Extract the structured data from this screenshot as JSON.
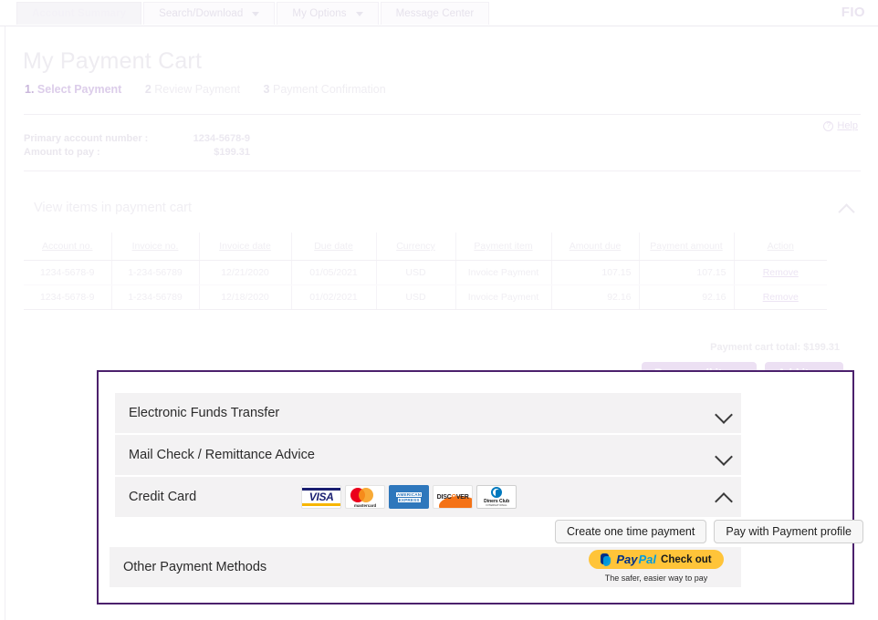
{
  "topnav": {
    "tabs": [
      {
        "label": "Account Summary",
        "active": true,
        "caret": false
      },
      {
        "label": "Search/Download",
        "active": false,
        "caret": true
      },
      {
        "label": "My Options",
        "active": false,
        "caret": true
      },
      {
        "label": "Message Center",
        "active": false,
        "caret": false
      }
    ],
    "brand": "FIO"
  },
  "page": {
    "title": "My Payment Cart",
    "steps": [
      {
        "num": "1.",
        "label": "Select Payment",
        "current": true
      },
      {
        "num": "2",
        "label": "Review Payment",
        "current": false
      },
      {
        "num": "3",
        "label": "Payment Confirmation",
        "current": false
      }
    ],
    "help": {
      "icon": "question-circle-icon",
      "label": "Help"
    }
  },
  "account_info": [
    {
      "key": "Primary account number :",
      "value": "1234-5678-9"
    },
    {
      "key": "Amount to pay :",
      "value": "$199.31"
    }
  ],
  "cart_section": {
    "header": "View items in payment cart",
    "collapse_icon": "chevron-up-icon",
    "columns": [
      "Account no.",
      "Invoice no.",
      "Invoice date",
      "Due date",
      "Currency",
      "Payment item",
      "Amount due",
      "Payment amount",
      "Action"
    ],
    "rows": [
      {
        "account_no": "1234-5678-9",
        "invoice_no": "1-234-56789",
        "invoice_date": "12/21/2020",
        "due_date": "01/05/2021",
        "currency": "USD",
        "payment_item": "Invoice Payment",
        "amount_due": "107.15",
        "payment_amount": "107.15",
        "action": "Remove"
      },
      {
        "account_no": "1234-5678-9",
        "invoice_no": "1-234-56789",
        "invoice_date": "12/18/2020",
        "due_date": "01/02/2021",
        "currency": "USD",
        "payment_item": "Invoice Payment",
        "amount_due": "92.16",
        "payment_amount": "92.16",
        "action": "Remove"
      }
    ],
    "total_label": "Payment cart total: $199.31",
    "remove_all_label": "Remove all items",
    "add_items_label": "Add items"
  },
  "payment_methods": {
    "border_color": "#4b206c",
    "eft": {
      "label": "Electronic Funds Transfer",
      "icon": "chevron-down-icon"
    },
    "mail": {
      "label": "Mail Check / Remittance Advice",
      "icon": "chevron-down-icon"
    },
    "credit_card": {
      "label": "Credit Card",
      "icon": "chevron-up-icon",
      "cards": [
        {
          "name": "visa-logo",
          "text": "VISA"
        },
        {
          "name": "mastercard-logo",
          "text": "mastercard"
        },
        {
          "name": "amex-logo",
          "line1": "AMERICAN",
          "line2": "EXPRESS"
        },
        {
          "name": "discover-logo",
          "pre": "DISC",
          "mid": "O",
          "post": "VER"
        },
        {
          "name": "diners-club-logo",
          "line1": "Diners Club",
          "line2": "INTERNATIONAL"
        }
      ],
      "one_time_label": "Create one time payment",
      "profile_label": "Pay with Payment profile"
    },
    "other": {
      "label": "Other Payment Methods",
      "paypal": {
        "icon": "paypal-icon",
        "pay": "Pay",
        "pal": "Pal",
        "checkout": "Check out",
        "tagline": "The safer, easier way to pay"
      }
    }
  }
}
